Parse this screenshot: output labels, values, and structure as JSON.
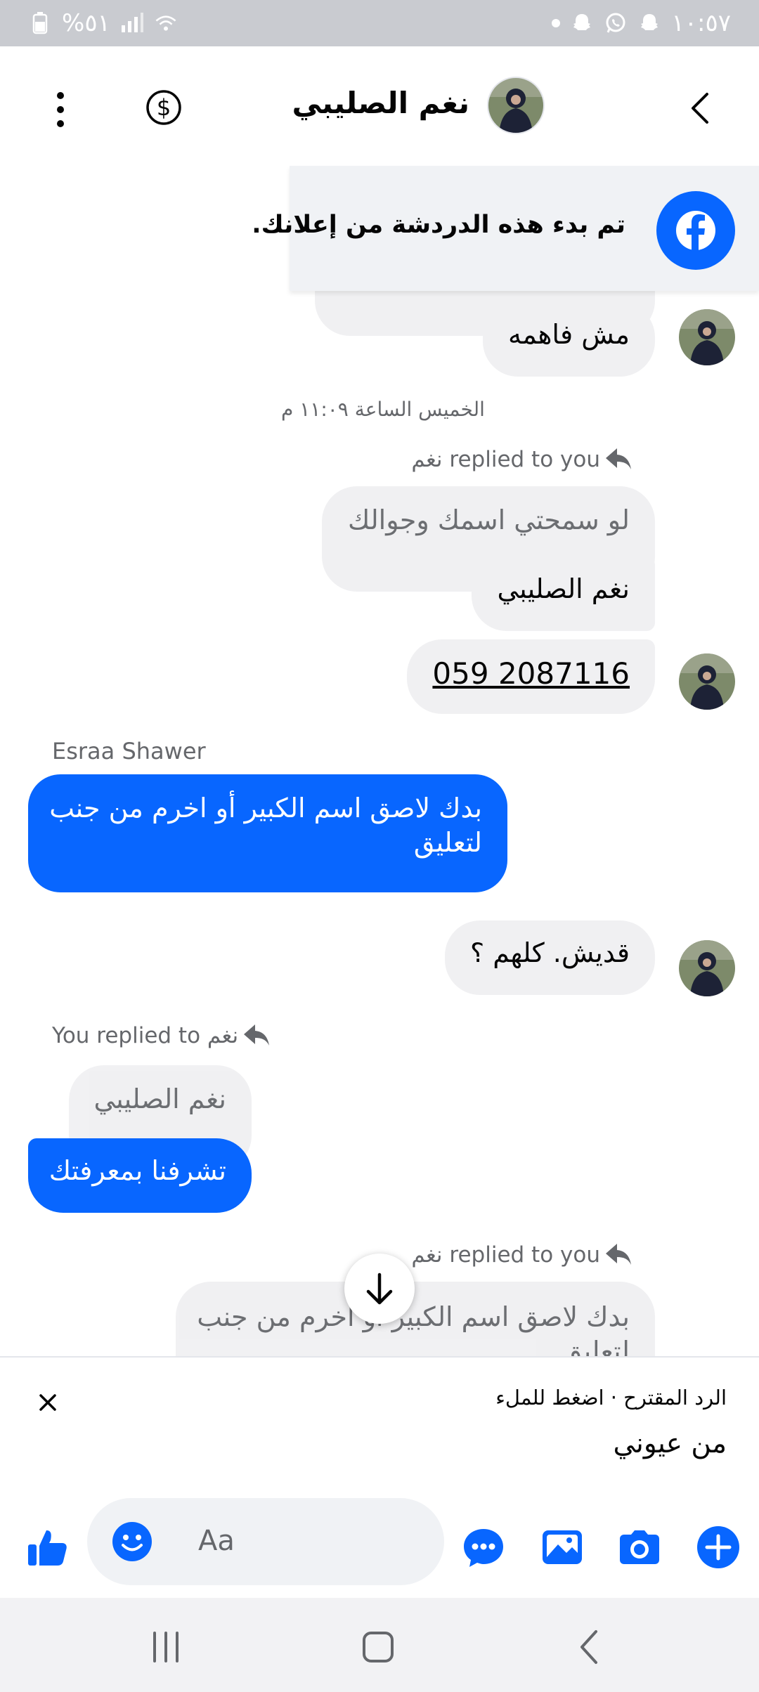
{
  "status_bar": {
    "time": "١٠:٥٧",
    "battery": "%٥١"
  },
  "header": {
    "contact_name": "نغم الصليبي"
  },
  "ad_banner": {
    "text": "تم بدء هذه الدردشة من إعلانك."
  },
  "messages": {
    "msg1": "مش فاهمه",
    "timestamp": "الخميس الساعة ١١:٠٩ م",
    "reply1_label": "نغم replied to you",
    "reply1_quote": "لو سمحتي اسمك وجوالك",
    "reply1_text": "نغم الصليبي",
    "phone": "059 2087116",
    "sender_name": "Esraa Shawer",
    "out1_line1": "بدك لاصق اسم الكبير أو اخرم من جنب",
    "out1_line2": "لتعليق",
    "msg_price": "قديش. كلهم ؟",
    "reply2_label": "You replied to نغم",
    "reply2_quote": "نغم الصليبي",
    "out2": "تشرفنا بمعرفتك",
    "reply3_label": "نغم replied to you",
    "reply3_quote_line1": "بدك لاصق اسم الكبير أو اخرم من جنب",
    "reply3_quote_line2": "لتعليق"
  },
  "suggestion": {
    "label": "الرد المقترح · اضغط للملء",
    "text": "من عيوني"
  },
  "composer": {
    "placeholder": "Aa"
  },
  "colors": {
    "accent": "#0866ff",
    "bubble_gray": "#f0f0f2",
    "muted": "#65676b"
  }
}
